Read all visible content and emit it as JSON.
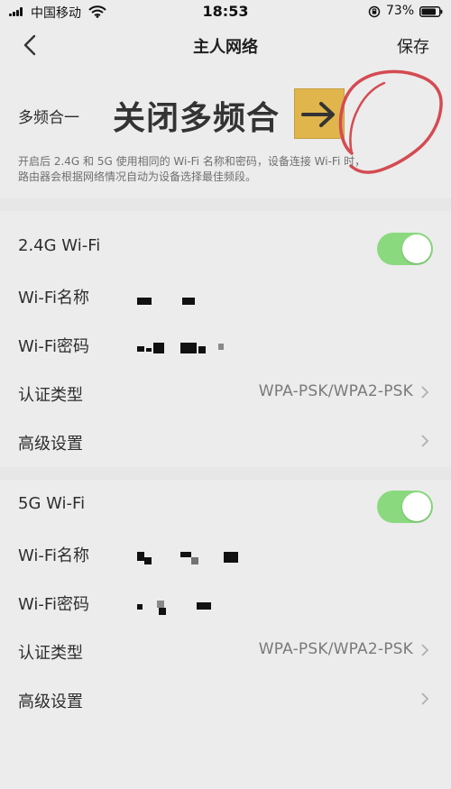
{
  "status_bar": {
    "carrier": "中国移动",
    "time": "18:53",
    "battery": "73%"
  },
  "nav": {
    "title": "主人网络",
    "save_label": "保存",
    "back_icon": "chevron-left-icon"
  },
  "multi_band": {
    "label": "多频合一",
    "annotation": "关闭多频合",
    "description": "开启后 2.4G 和 5G 使用相同的 Wi-Fi 名称和密码，设备连接 Wi-Fi 时，\n路由器会根据网络情况自动为设备选择最佳频段。",
    "arrow_icon": "arrow-right-icon"
  },
  "sections": [
    {
      "title": "2.4G Wi-Fi",
      "enabled": true,
      "wifi_name_label": "Wi-Fi名称",
      "wifi_password_label": "Wi-Fi密码",
      "auth_label": "认证类型",
      "auth_value": "WPA-PSK/WPA2-PSK",
      "advanced_label": "高级设置"
    },
    {
      "title": "5G Wi-Fi",
      "enabled": true,
      "wifi_name_label": "Wi-Fi名称",
      "wifi_password_label": "Wi-Fi密码",
      "auth_label": "认证类型",
      "auth_value": "WPA-PSK/WPA2-PSK",
      "advanced_label": "高级设置"
    }
  ],
  "colors": {
    "background": "#ececec",
    "toggle_on": "#8ad97f",
    "annotation_box": "#e0b54c",
    "annotation_circle": "#d44b52"
  }
}
